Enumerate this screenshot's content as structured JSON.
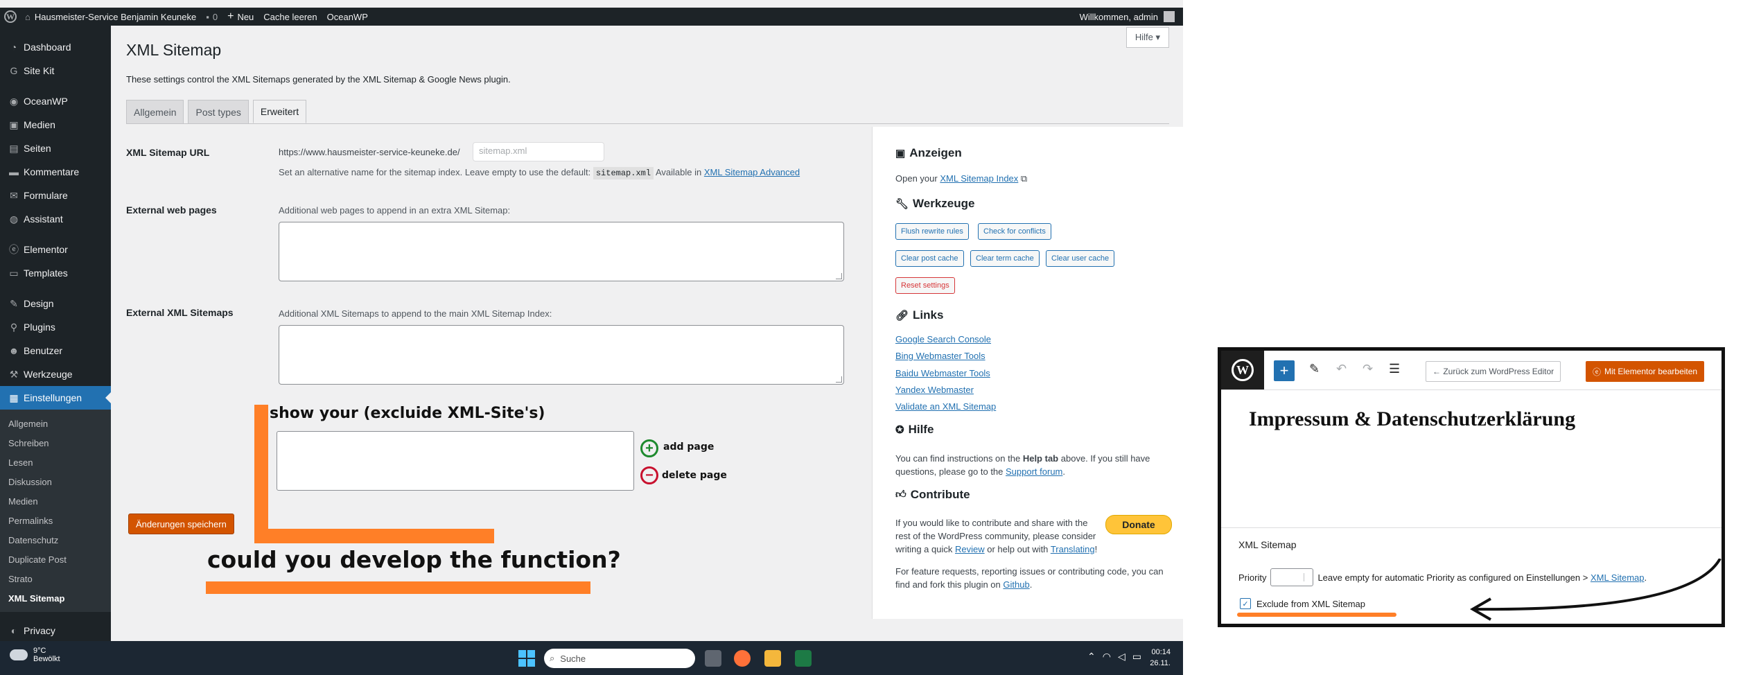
{
  "adminbar": {
    "site_name": "Hausmeister-Service Benjamin Keuneke",
    "comments": "0",
    "new": "Neu",
    "cache": "Cache leeren",
    "theme": "OceanWP",
    "welcome": "Willkommen, admin"
  },
  "sidebar": {
    "items": [
      "Dashboard",
      "Site Kit",
      "OceanWP",
      "Medien",
      "Seiten",
      "Kommentare",
      "Formulare",
      "Assistant",
      "Elementor",
      "Templates",
      "Design",
      "Plugins",
      "Benutzer",
      "Werkzeuge",
      "Einstellungen"
    ],
    "submenu": [
      "Allgemein",
      "Schreiben",
      "Lesen",
      "Diskussion",
      "Medien",
      "Permalinks",
      "Datenschutz",
      "Duplicate Post",
      "Strato",
      "XML Sitemap"
    ],
    "privacy": "Privacy"
  },
  "page": {
    "help": "Hilfe ▾",
    "title": "XML Sitemap",
    "description": "These settings control the XML Sitemaps generated by the XML Sitemap & Google News plugin.",
    "tabs": [
      "Allgemein",
      "Post types",
      "Erweitert"
    ],
    "sitemap_url_label": "XML Sitemap URL",
    "sitemap_url_prefix": "https://www.hausmeister-service-keuneke.de/",
    "sitemap_url_placeholder": "sitemap.xml",
    "sitemap_help_1": "Set an alternative name for the sitemap index. Leave empty to use the default:",
    "sitemap_help_code": "sitemap.xml",
    "sitemap_help_2": "Available in",
    "sitemap_help_link": "XML Sitemap Advanced",
    "external_pages_label": "External web pages",
    "external_pages_help": "Additional web pages to append in an extra XML Sitemap:",
    "external_sitemaps_label": "External XML Sitemaps",
    "external_sitemaps_help": "Additional XML Sitemaps to append to the main XML Sitemap Index:",
    "save": "Änderungen speichern"
  },
  "annotation": {
    "title": "show your (excluide XML-Site's)",
    "add": "add page",
    "delete": "delete page",
    "question": "could you develop the function?"
  },
  "right_panel": {
    "anzeigen_h": "Anzeigen",
    "anzeigen_text": "Open your",
    "anzeigen_link": "XML Sitemap Index",
    "werkzeuge_h": "Werkzeuge",
    "buttons": [
      "Flush rewrite rules",
      "Check for conflicts",
      "Clear post cache",
      "Clear term cache",
      "Clear user cache",
      "Reset settings"
    ],
    "links_h": "Links",
    "links": [
      "Google Search Console",
      "Bing Webmaster Tools",
      "Baidu Webmaster Tools",
      "Yandex Webmaster",
      "Validate an XML Sitemap"
    ],
    "hilfe_h": "Hilfe",
    "hilfe_text_1": "You can find instructions on the",
    "hilfe_text_bold": "Help tab",
    "hilfe_text_2": "above. If you still have questions, please go to the",
    "hilfe_link": "Support forum",
    "contribute_h": "Contribute",
    "contribute_1": "If you would like to contribute and share with the rest of the WordPress community, please consider writing a quick",
    "contribute_review": "Review",
    "contribute_2": "or help out with",
    "contribute_translating": "Translating",
    "contribute_3": "For feature requests, reporting issues or contributing code, you can find and fork this plugin on",
    "contribute_github": "Github",
    "donate": "Donate"
  },
  "taskbar": {
    "temp": "9°C",
    "weather": "Bewölkt",
    "search": "Suche",
    "time": "00:14",
    "date": "26.11."
  },
  "elementor": {
    "back": "← Zurück zum WordPress Editor",
    "edit": "Mit Elementor bearbeiten",
    "page_title": "Impressum & Datenschutzerklärung",
    "section": "XML Sitemap",
    "priority": "Priority",
    "priority_help": "Leave empty for automatic Priority as configured on Einstellungen >",
    "priority_link": "XML Sitemap",
    "exclude": "Exclude from XML Sitemap"
  },
  "colors": {
    "accent": "#2271b1",
    "annotation": "#ff7f27",
    "save": "#d35400",
    "donate": "#ffc439"
  }
}
